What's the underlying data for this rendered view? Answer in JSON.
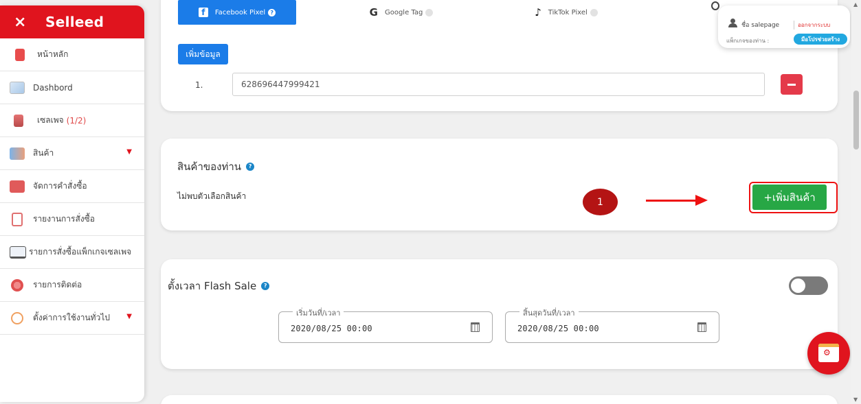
{
  "sidebar": {
    "logo": "Selleed",
    "close_symbol": "×",
    "items": [
      {
        "label": "หน้าหลัก",
        "icon": "home-icon"
      },
      {
        "label": "Dashbord",
        "icon": "dashboard-icon"
      },
      {
        "label": "เซลเพจ",
        "count": "(1/2)",
        "icon": "salepage-icon"
      },
      {
        "label": "สินค้า",
        "icon": "products-icon",
        "caret": "▼"
      },
      {
        "label": "จัดการคำสั่งซื้อ",
        "icon": "manage-orders-icon"
      },
      {
        "label": "รายงานการสั่งซื้อ",
        "icon": "order-report-icon"
      },
      {
        "label": "รายการสั่งซื้อแพ็กเกจเซลเพจ",
        "icon": "package-orders-icon"
      },
      {
        "label": "รายการติดต่อ",
        "icon": "contacts-icon"
      },
      {
        "label": "ตั้งค่าการใช้งานทั่วไป",
        "icon": "settings-icon",
        "caret": "▼"
      }
    ]
  },
  "pixel_tabs": [
    {
      "label": "Facebook Pixel",
      "icon": "f",
      "active": true
    },
    {
      "label": "Google Tag",
      "icon": "G",
      "active": false
    },
    {
      "label": "TikTok Pixel",
      "icon": "♪",
      "active": false
    }
  ],
  "pixel_section": {
    "add_button": "เพิ่มข้อมูล",
    "row_number": "1.",
    "pixel_value": "628696447999421"
  },
  "products_section": {
    "title": "สินค้าของท่าน",
    "empty_text": "ไม่พบตัวเลือกสินค้า",
    "add_button": "+เพิ่มสินค้า",
    "step_badge": "1"
  },
  "flash_sale": {
    "title": "ตั้งเวลา Flash Sale",
    "start_label": "เริ่มวันที่/เวลา",
    "start_value": "2020/08/25 00:00",
    "end_label": "สิ้นสุดวันที่/เวลา",
    "end_value": "2020/08/25 00:00",
    "enabled": false
  },
  "user_popup": {
    "name": "ชื่อ salepage",
    "logout": "ออกจากระบบ",
    "package_label": "แพ็กเกจของท่าน :",
    "package_badge": "มือโปรช่วยสร้าง"
  },
  "colors": {
    "brand_red": "#e0141e",
    "primary_blue": "#1b7ce8",
    "success_green": "#27a745",
    "annotation_red": "#ee1111"
  }
}
